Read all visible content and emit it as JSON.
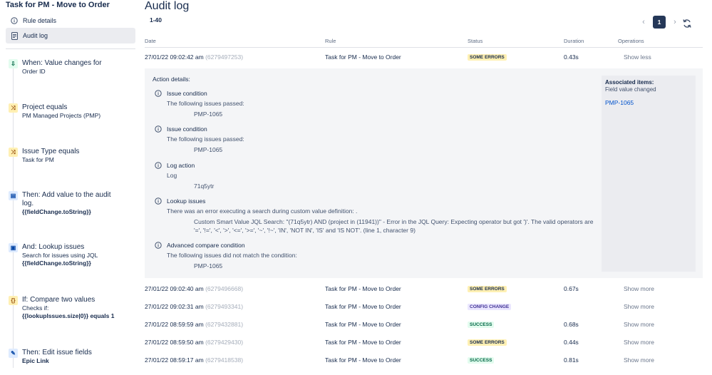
{
  "sidebar": {
    "rule_title": "Task for PM - Move to Order",
    "nav": [
      {
        "label": "Rule details",
        "icon": "info-icon"
      },
      {
        "label": "Audit log",
        "icon": "document-icon"
      }
    ],
    "steps": [
      {
        "icon": "trigger-icon",
        "glyph": "⇩",
        "title": "When: Value changes for",
        "desc": "Order ID",
        "bold": ""
      },
      {
        "icon": "shuffle-icon",
        "glyph": "⤨",
        "title": "Project equals",
        "desc": "PM Managed Projects (PMP)",
        "bold": ""
      },
      {
        "icon": "shuffle-icon",
        "glyph": "⤨",
        "title": "Issue Type equals",
        "desc": "Task for PM",
        "bold": ""
      },
      {
        "icon": "document-icon",
        "glyph": "▤",
        "title": "Then: Add value to the audit log.",
        "desc": "",
        "bold": "{{fieldChange.toString}}"
      },
      {
        "icon": "lookup-icon",
        "glyph": "▣",
        "title": "And: Lookup issues",
        "desc": "Search for issues using JQL",
        "bold": "{{fieldChange.toString}}"
      },
      {
        "icon": "braces-icon",
        "glyph": "{}",
        "title": "If: Compare two values",
        "desc": "Checks if:",
        "bold": "{{lookupIssues.size|0}} equals 1"
      },
      {
        "icon": "pencil-icon",
        "glyph": "✎",
        "title": "Then: Edit issue fields",
        "desc": "",
        "bold": "Epic Link"
      }
    ]
  },
  "main": {
    "title": "Audit log",
    "range": "1-40",
    "pager": {
      "prev": "‹",
      "page": "1",
      "next": "›"
    },
    "columns": {
      "date": "Date",
      "rule": "Rule",
      "status": "Status",
      "duration": "Duration",
      "operations": "Operations"
    },
    "rows": [
      {
        "date": "27/01/22 09:02:42 am",
        "id": "(6279497253)",
        "rule": "Task for PM - Move to Order",
        "status": "SOME ERRORS",
        "status_kind": "some",
        "duration": "0.43s",
        "op": "Show less"
      },
      {
        "date": "27/01/22 09:02:40 am",
        "id": "(6279496668)",
        "rule": "Task for PM - Move to Order",
        "status": "SOME ERRORS",
        "status_kind": "some",
        "duration": "0.67s",
        "op": "Show more"
      },
      {
        "date": "27/01/22 09:02:31 am",
        "id": "(6279493341)",
        "rule": "Task for PM - Move to Order",
        "status": "CONFIG CHANGE",
        "status_kind": "config",
        "duration": "",
        "op": "Show more"
      },
      {
        "date": "27/01/22 08:59:59 am",
        "id": "(6279432881)",
        "rule": "Task for PM - Move to Order",
        "status": "SUCCESS",
        "status_kind": "success",
        "duration": "0.68s",
        "op": "Show more"
      },
      {
        "date": "27/01/22 08:59:50 am",
        "id": "(6279429430)",
        "rule": "Task for PM - Move to Order",
        "status": "SOME ERRORS",
        "status_kind": "some",
        "duration": "0.44s",
        "op": "Show more"
      },
      {
        "date": "27/01/22 08:59:17 am",
        "id": "(6279418538)",
        "rule": "Task for PM - Move to Order",
        "status": "SUCCESS",
        "status_kind": "success",
        "duration": "0.81s",
        "op": "Show more"
      }
    ],
    "details": {
      "label": "Action details:",
      "entries": [
        {
          "title": "Issue condition",
          "sub": "The following issues passed:",
          "value": "PMP-1065"
        },
        {
          "title": "Issue condition",
          "sub": "The following issues passed:",
          "value": "PMP-1065"
        },
        {
          "title": "Log action",
          "sub": "Log",
          "value": "71q5ytr"
        },
        {
          "title": "Lookup issues",
          "sub": "There was an error executing a search during custom value definition: .",
          "value": "Custom Smart Value JQL Search: \"(71q5ytr) AND (project in (11941))\" - Error in the JQL Query: Expecting operator but got ')'. The valid operators are '=', '!=', '<', '>', '<=', '>=', '~', '!~', 'IN', 'NOT IN', 'IS' and 'IS NOT'. (line 1, character 9)"
        },
        {
          "title": "Advanced compare condition",
          "sub": "The following issues did not match the condition:",
          "value": "PMP-1065"
        }
      ],
      "associated": {
        "title": "Associated items:",
        "sub": "Field value changed",
        "link": "PMP-1065"
      }
    }
  },
  "colors": {
    "primary_dark": "#253858",
    "link": "#0052cc",
    "text": "#172b4d",
    "muted": "#6b778c"
  }
}
